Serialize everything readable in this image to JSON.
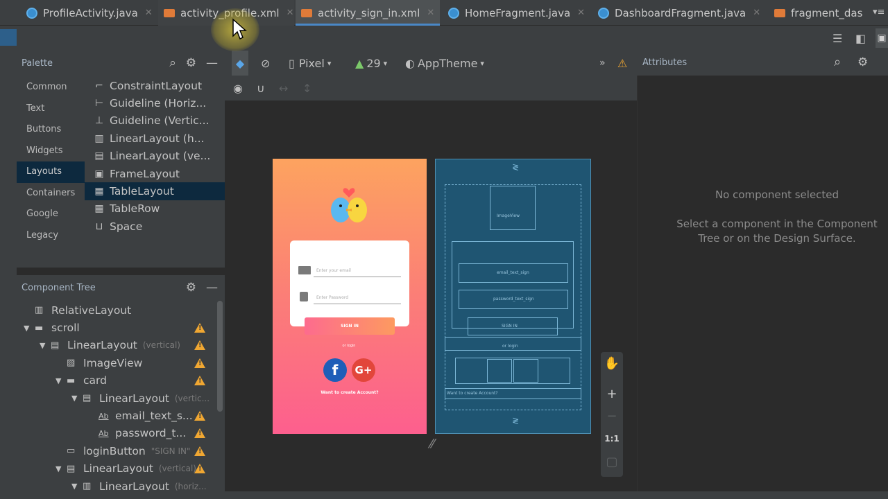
{
  "tabs": [
    {
      "label": "ProfileActivity.java",
      "icon": "java-class-icon"
    },
    {
      "label": "activity_profile.xml",
      "icon": "xml-layout-icon"
    },
    {
      "label": "activity_sign_in.xml",
      "icon": "xml-layout-icon",
      "active": true
    },
    {
      "label": "HomeFragment.java",
      "icon": "java-class-icon"
    },
    {
      "label": "DashboardFragment.java",
      "icon": "java-class-icon"
    },
    {
      "label": "fragment_das",
      "icon": "xml-layout-icon"
    }
  ],
  "palette": {
    "title": "Palette",
    "categories": [
      "Common",
      "Text",
      "Buttons",
      "Widgets",
      "Layouts",
      "Containers",
      "Google",
      "Legacy"
    ],
    "selected_category": "Layouts",
    "items": [
      {
        "label": "ConstraintLayout",
        "icon": "constraint-layout-icon"
      },
      {
        "label": "Guideline (Horiz...",
        "icon": "horizontal-guideline-icon"
      },
      {
        "label": "Guideline (Vertic...",
        "icon": "vertical-guideline-icon"
      },
      {
        "label": "LinearLayout (h...",
        "icon": "linear-horizontal-icon"
      },
      {
        "label": "LinearLayout (ve...",
        "icon": "linear-vertical-icon"
      },
      {
        "label": "FrameLayout",
        "icon": "frame-layout-icon"
      },
      {
        "label": "TableLayout",
        "icon": "table-layout-icon",
        "selected": true
      },
      {
        "label": "TableRow",
        "icon": "table-row-icon"
      },
      {
        "label": "Space",
        "icon": "space-icon"
      }
    ]
  },
  "component_tree": {
    "title": "Component Tree",
    "nodes": [
      {
        "label": "RelativeLayout",
        "hint": "",
        "depth": 0,
        "arrow": "",
        "icon": "relative-layout-icon",
        "warn": false
      },
      {
        "label": "scroll",
        "hint": "",
        "depth": 0,
        "arrow": "▼",
        "icon": "scroll-view-icon",
        "warn": true
      },
      {
        "label": "LinearLayout",
        "hint": "(vertical)",
        "depth": 1,
        "arrow": "▼",
        "icon": "linear-vertical-icon",
        "warn": true
      },
      {
        "label": "ImageView",
        "hint": "",
        "depth": 2,
        "arrow": "",
        "icon": "image-view-icon",
        "warn": true
      },
      {
        "label": "card",
        "hint": "",
        "depth": 2,
        "arrow": "▼",
        "icon": "card-view-icon",
        "warn": true
      },
      {
        "label": "LinearLayout",
        "hint": "(vertic...",
        "depth": 3,
        "arrow": "▼",
        "icon": "linear-vertical-icon",
        "warn": false
      },
      {
        "label": "email_text_s...",
        "hint": "",
        "depth": 4,
        "arrow": "",
        "icon": "text-field-icon",
        "warn": true
      },
      {
        "label": "password_t...",
        "hint": "",
        "depth": 4,
        "arrow": "",
        "icon": "text-field-icon",
        "warn": true
      },
      {
        "label": "loginButton",
        "hint": "\"SIGN IN\"",
        "depth": 2,
        "arrow": "",
        "icon": "button-icon",
        "warn": true
      },
      {
        "label": "LinearLayout",
        "hint": "(vertical)",
        "depth": 2,
        "arrow": "▼",
        "icon": "linear-vertical-icon",
        "warn": true
      },
      {
        "label": "LinearLayout",
        "hint": "(horiz...",
        "depth": 3,
        "arrow": "▼",
        "icon": "linear-horizontal-icon",
        "warn": false
      }
    ]
  },
  "design_toolbar": {
    "device": "Pixel",
    "api": "29",
    "theme": "AppTheme"
  },
  "phone": {
    "email_placeholder": "Enter your email",
    "password_placeholder": "Enter Password",
    "sign_in": "SIGN IN",
    "or": "or login",
    "facebook": "f",
    "google": "G+",
    "create_account": "Want to create Account?"
  },
  "blueprint": {
    "image_view": "ImageView",
    "email": "email_text_sign",
    "password": "password_text_sign",
    "login": "SIGN IN",
    "or": "or login",
    "create": "Want to create Account?",
    "img": "ImageView"
  },
  "zoom": {
    "ratio": "1:1"
  },
  "attributes": {
    "title": "Attributes",
    "empty_title": "No component selected",
    "empty_hint": "Select a component in the Component Tree or on the Design Surface."
  },
  "colors": {
    "accent": "#4a88c7",
    "warning": "#f0a732",
    "blueprint": "#1f5572"
  }
}
